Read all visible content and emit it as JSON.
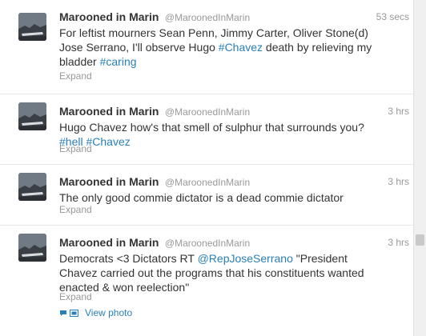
{
  "tweets": [
    {
      "name": "Marooned in Marin",
      "handle": "@MaroonedInMarin",
      "time": "53 secs",
      "text_parts": [
        {
          "t": "For leftist mourners Sean Penn, Jimmy Carter, Oliver Stone(d) Jose Serrano, I'll observe Hugo "
        },
        {
          "a": "#Chavez"
        },
        {
          "t": " death by relieving my bladder "
        },
        {
          "a": "#caring"
        }
      ],
      "expand": "Expand"
    },
    {
      "name": "Marooned in Marin",
      "handle": "@MaroonedInMarin",
      "time": "3 hrs",
      "text_parts": [
        {
          "t": "Hugo Chavez how's that smell of sulphur that surrounds you? "
        },
        {
          "a": "#hell"
        },
        {
          "t": " "
        },
        {
          "a": "#Chavez"
        }
      ],
      "expand": "Expand"
    },
    {
      "name": "Marooned in Marin",
      "handle": "@MaroonedInMarin",
      "time": "3 hrs",
      "text_parts": [
        {
          "t": "The only good commie dictator is a dead commie dictator"
        }
      ],
      "expand": "Expand"
    },
    {
      "name": "Marooned in Marin",
      "handle": "@MaroonedInMarin",
      "time": "3 hrs",
      "text_parts": [
        {
          "t": "Democrats <3 Dictators RT "
        },
        {
          "a": "@RepJoseSerrano"
        },
        {
          "t": " \"President Chavez carried out the programs that his constituents wanted enacted & won reelection\""
        }
      ],
      "expand": "Expand",
      "view_photo": "View photo"
    }
  ],
  "colors": {
    "link": "#2a7fb7",
    "meta": "#999999",
    "text": "#333333"
  },
  "icons": [
    "speech-bubble-icon",
    "photo-icon"
  ]
}
